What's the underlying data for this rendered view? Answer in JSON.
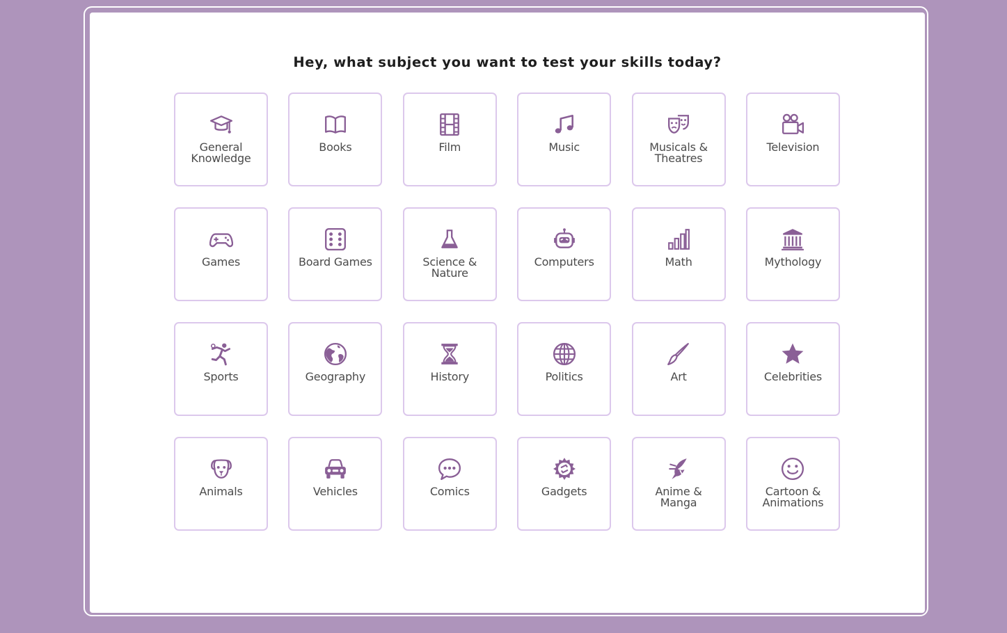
{
  "heading": "Hey, what subject you want to test your skills today?",
  "colors": {
    "background": "#ae94bb",
    "card_border": "#dcc8ec",
    "icon": "#8a5f96"
  },
  "categories": [
    {
      "label": "General Knowledge",
      "icon": "graduation-cap-icon"
    },
    {
      "label": "Books",
      "icon": "open-book-icon"
    },
    {
      "label": "Film",
      "icon": "film-strip-icon"
    },
    {
      "label": "Music",
      "icon": "music-note-icon"
    },
    {
      "label": "Musicals & Theatres",
      "icon": "theater-masks-icon"
    },
    {
      "label": "Television",
      "icon": "video-camera-icon"
    },
    {
      "label": "Games",
      "icon": "gamepad-icon"
    },
    {
      "label": "Board Games",
      "icon": "dice-icon"
    },
    {
      "label": "Science & Nature",
      "icon": "flask-icon"
    },
    {
      "label": "Computers",
      "icon": "robot-icon"
    },
    {
      "label": "Math",
      "icon": "bar-chart-icon"
    },
    {
      "label": "Mythology",
      "icon": "temple-icon"
    },
    {
      "label": "Sports",
      "icon": "athlete-icon"
    },
    {
      "label": "Geography",
      "icon": "globe-earth-icon"
    },
    {
      "label": "History",
      "icon": "hourglass-icon"
    },
    {
      "label": "Politics",
      "icon": "globe-grid-icon"
    },
    {
      "label": "Art",
      "icon": "paintbrush-icon"
    },
    {
      "label": "Celebrities",
      "icon": "star-icon"
    },
    {
      "label": "Animals",
      "icon": "dog-icon"
    },
    {
      "label": "Vehicles",
      "icon": "car-icon"
    },
    {
      "label": "Comics",
      "icon": "speech-bubble-icon"
    },
    {
      "label": "Gadgets",
      "icon": "gear-icon"
    },
    {
      "label": "Anime & Manga",
      "icon": "anime-character-icon"
    },
    {
      "label": "Cartoon & Animations",
      "icon": "smiley-face-icon"
    }
  ]
}
